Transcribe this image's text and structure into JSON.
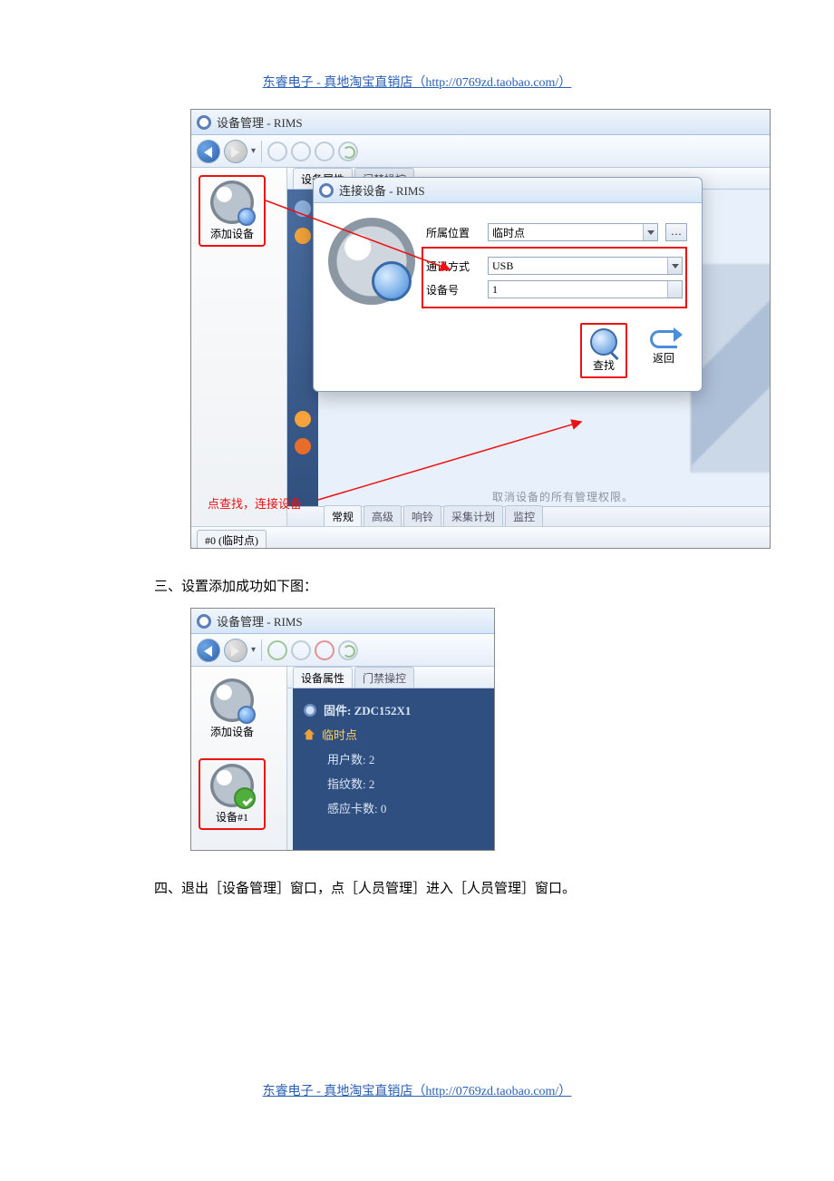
{
  "header_link": "东睿电子 - 真地淘宝直销店（http://0769zd.taobao.com/）",
  "footer_link": "东睿电子 - 真地淘宝直销店（http://0769zd.taobao.com/）",
  "section3_text": "三、设置添加成功如下图：",
  "section4_text": "四、退出［设备管理］窗口，点［人员管理］进入［人员管理］窗口。",
  "fig1": {
    "window_title": "设备管理 - RIMS",
    "sidebar": {
      "add_device": "添加设备"
    },
    "tabs_top": {
      "props": "设备属性",
      "door": "门禁操控"
    },
    "dialog": {
      "title": "连接设备 - RIMS",
      "rows": {
        "location_label": "所属位置",
        "location_value": "临时点",
        "comm_label": "通讯方式",
        "comm_value": "USB",
        "devno_label": "设备号",
        "devno_value": "1"
      },
      "search_btn": "查找",
      "back_btn": "返回"
    },
    "gray_hint": "取消设备的所有管理权限。",
    "red_caption": "点查找，连接设备",
    "tabs_bottom": {
      "t1": "常规",
      "t2": "高级",
      "t3": "响铃",
      "t4": "采集计划",
      "t5": "监控"
    },
    "status_chip": "#0 (临时点)"
  },
  "fig2": {
    "window_title": "设备管理 - RIMS",
    "sidebar": {
      "add_device": "添加设备",
      "device1": "设备#1"
    },
    "tabs_top": {
      "props": "设备属性",
      "door": "门禁操控"
    },
    "panel": {
      "firmware_label": "固件:",
      "firmware_value": "ZDC152X1",
      "node": "临时点",
      "users": "用户数: 2",
      "fps": "指纹数: 2",
      "cards": "感应卡数: 0"
    }
  }
}
